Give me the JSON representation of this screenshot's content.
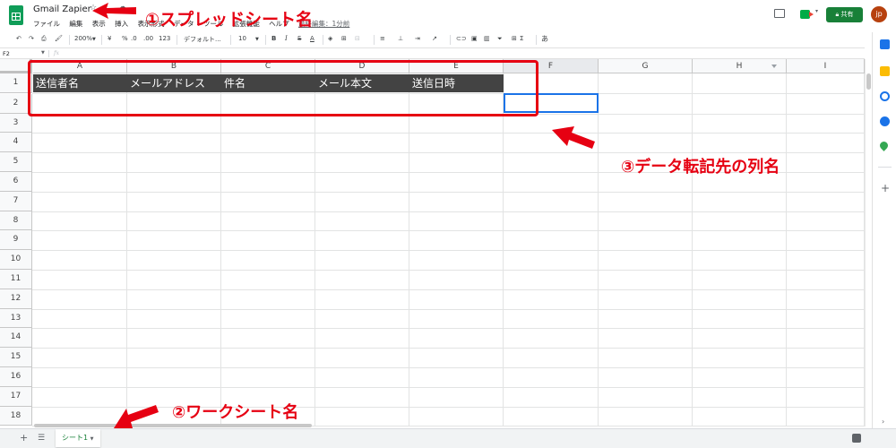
{
  "app": {
    "title": "Gmail Zapier",
    "menus": [
      "ファイル",
      "編集",
      "表示",
      "挿入",
      "表示形式",
      "データ",
      "ツール",
      "拡張機能",
      "ヘルプ",
      "最終編集：1分前"
    ],
    "share_label": "共有",
    "avatar_initials": "jp"
  },
  "toolbar": {
    "zoom": "200%",
    "currency": "¥",
    "percent": "%",
    "dec_decrease": ".0",
    "dec_increase": ".00",
    "format_more": "123",
    "font": "デフォルト...",
    "font_size": "10",
    "bold": "B",
    "italic": "I",
    "strike": "S",
    "text_color": "A",
    "sum": "Σ",
    "input_tools": "あ"
  },
  "formula_bar": {
    "name_box": "F2",
    "fx": "fx",
    "value": ""
  },
  "grid": {
    "columns": [
      "A",
      "B",
      "C",
      "D",
      "E",
      "F",
      "G",
      "H",
      "I"
    ],
    "rows": [
      "1",
      "2",
      "3",
      "4",
      "5",
      "6",
      "7",
      "8",
      "9",
      "10",
      "11",
      "12",
      "13",
      "14",
      "15",
      "16",
      "17",
      "18"
    ],
    "header_cells": [
      "送信者名",
      "メールアドレス",
      "件名",
      "メール本文",
      "送信日時"
    ],
    "selected_cell": "F2",
    "header_fill_color": "#434343",
    "selection_color": "#1a73e8"
  },
  "tabs": {
    "sheets": [
      "シート1"
    ]
  },
  "annotations": {
    "spreadsheet_name": "①スプレッドシート名",
    "worksheet_name": "②ワークシート名",
    "column_names": "③データ転記先の列名",
    "color": "#e60012"
  }
}
